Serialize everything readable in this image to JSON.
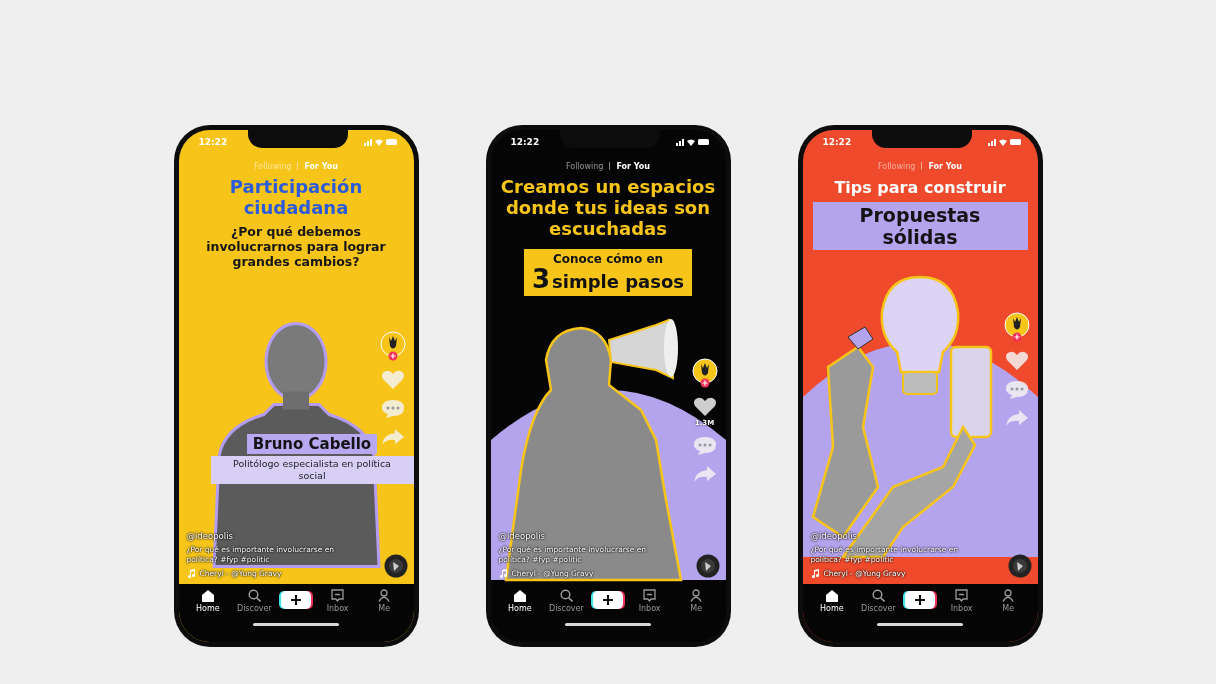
{
  "phones": [
    {
      "kind": "yellow",
      "status_time": "12:22",
      "tabs": [
        {
          "label": "Following",
          "selected": false
        },
        {
          "label": "For You",
          "selected": true
        }
      ],
      "headline": [
        {
          "kind": "title",
          "text": "Participación ciudadana"
        },
        {
          "kind": "subtitle",
          "text": "¿Por qué debemos involucrarnos para lograr grandes cambios?"
        }
      ],
      "media": {
        "kind": "portrait",
        "name": "Bruno Cabello",
        "role": "Politólogo especialista en política social"
      },
      "caption": {
        "user": "@ideopolis",
        "text": "¿Por qué es importante involucrarse en política? #fyp #politic",
        "music": "Cheryl - @Yung Gravy"
      },
      "nav": [
        {
          "kind": "home",
          "label": "Home",
          "selected": true
        },
        {
          "kind": "discover",
          "label": "Discover",
          "selected": false
        },
        {
          "kind": "create",
          "selected": false
        },
        {
          "kind": "inbox",
          "label": "Inbox",
          "selected": false
        },
        {
          "kind": "me",
          "label": "Me",
          "selected": false
        }
      ]
    },
    {
      "kind": "black",
      "status_time": "12:22",
      "tabs": [
        {
          "label": "Following",
          "selected": false
        },
        {
          "label": "For You",
          "selected": true
        }
      ],
      "headline": [
        {
          "kind": "title",
          "text": "Creamos un espacios donde tus ideas son escuchadas"
        },
        {
          "kind": "steps_box",
          "text": "Conoce cómo en",
          "number": "3",
          "rest": "simple pasos"
        }
      ],
      "media": {
        "kind": "megaphone"
      },
      "like_count": "1.3M",
      "caption": {
        "user": "@ideopolis",
        "text": "¿Por qué es importante involucrarse en política? #fyp #politic",
        "music": "Cheryl - @Yung Gravy"
      },
      "nav": [
        {
          "kind": "home",
          "label": "Home",
          "selected": true
        },
        {
          "kind": "discover",
          "label": "Discover",
          "selected": false
        },
        {
          "kind": "create",
          "selected": false
        },
        {
          "kind": "inbox",
          "label": "Inbox",
          "selected": false
        },
        {
          "kind": "me",
          "label": "Me",
          "selected": false
        }
      ]
    },
    {
      "kind": "red",
      "status_time": "12:22",
      "tabs": [
        {
          "label": "Following",
          "selected": false
        },
        {
          "label": "For You",
          "selected": true
        }
      ],
      "headline": [
        {
          "kind": "lead",
          "text": "Tips para construir"
        },
        {
          "kind": "box",
          "text": "Propuestas sólidas"
        }
      ],
      "media": {
        "kind": "bulb"
      },
      "caption": {
        "user": "@ideopolis",
        "text": "¿Por qué es importante involucrarse en política? #fyp #politic",
        "music": "Cheryl - @Yung Gravy"
      },
      "nav": [
        {
          "kind": "home",
          "label": "Home",
          "selected": true
        },
        {
          "kind": "discover",
          "label": "Discover",
          "selected": false
        },
        {
          "kind": "create",
          "selected": false
        },
        {
          "kind": "inbox",
          "label": "Inbox",
          "selected": false
        },
        {
          "kind": "me",
          "label": "Me",
          "selected": false
        }
      ]
    }
  ]
}
